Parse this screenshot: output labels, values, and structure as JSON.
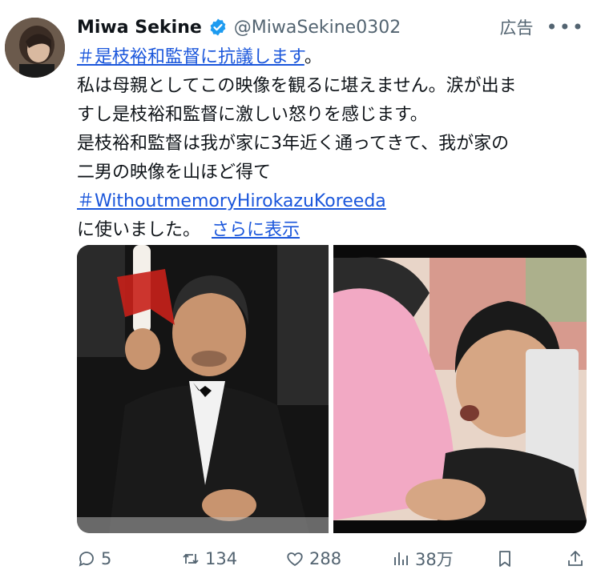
{
  "post": {
    "author_name": "Miwa Sekine",
    "handle": "@MiwaSekine0302",
    "ad_label": "広告",
    "more": "•••",
    "hashtag1": "＃是枝裕和監督に抗議します",
    "after_hashtag1": "。",
    "line2": "私は母親としてこの映像を観るに堪えません。涙が出ま",
    "line3": "すし是枝裕和監督に激しい怒りを感じます。",
    "line4": "是枝裕和監督は我が家に3年近く通ってきて、我が家の",
    "line5": "二男の映像を山ほど得て",
    "hashtag2": "＃WithoutmemoryHirokazuKoreeda",
    "line7": "に使いました。",
    "show_more": "さらに表示"
  },
  "actions": {
    "replies": "5",
    "reposts": "134",
    "likes": "288",
    "views": "38万"
  },
  "icons": [
    "verified-badge-icon",
    "reply-icon",
    "repost-icon",
    "like-icon",
    "views-icon",
    "bookmark-icon",
    "share-icon"
  ],
  "colors": {
    "link": "#1a56db",
    "verified": "#1d9bf0",
    "muted": "#536471"
  }
}
